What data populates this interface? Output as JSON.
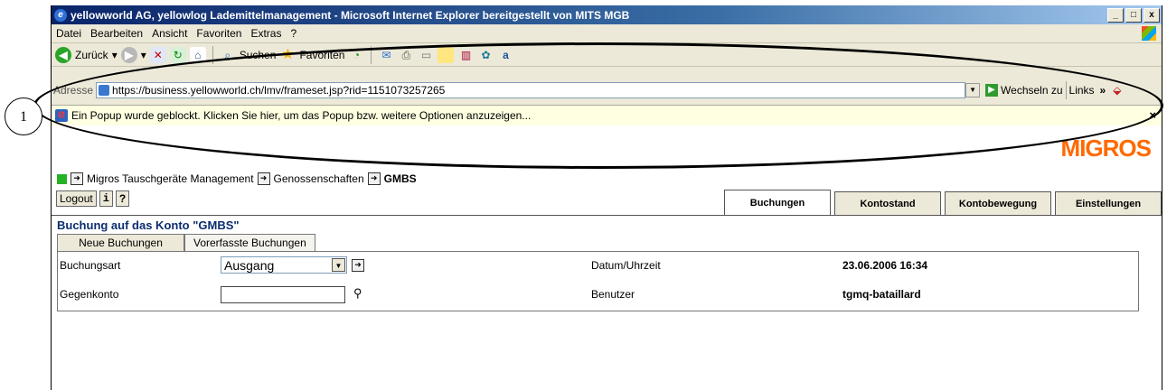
{
  "window": {
    "title": "yellowworld AG, yellowlog Lademittelmanagement - Microsoft Internet Explorer bereitgestellt von MITS MGB",
    "controls": [
      "_",
      "□",
      "x"
    ]
  },
  "menu": [
    "Datei",
    "Bearbeiten",
    "Ansicht",
    "Favoriten",
    "Extras",
    "?"
  ],
  "toolbar": {
    "back_label": "Zurück",
    "search_label": "Suchen",
    "favorites_label": "Favoriten"
  },
  "address": {
    "label": "Adresse",
    "url": "https://business.yellowworld.ch/lmv/frameset.jsp?rid=1151073257265",
    "go_label": "Wechseln zu",
    "links_label": "Links"
  },
  "popup": {
    "message": "Ein Popup wurde geblockt. Klicken Sie hier, um das Popup bzw. weitere Optionen anzuzeigen...",
    "close": "×"
  },
  "brand": "MIGROS",
  "breadcrumb": [
    "Migros Tauschgeräte Management",
    "Genossenschaften",
    "GMBS"
  ],
  "buttons": {
    "logout": "Logout",
    "info": "i",
    "help": "?"
  },
  "main_tabs": [
    "Buchungen",
    "Kontostand",
    "Kontobewegung",
    "Einstellungen"
  ],
  "heading": "Buchung auf das Konto \"GMBS\"",
  "sub_tabs": [
    "Neue Buchungen",
    "Vorerfasste Buchungen"
  ],
  "form": {
    "buchungsart_label": "Buchungsart",
    "buchungsart_value": "Ausgang",
    "gegenkonto_label": "Gegenkonto",
    "gegenkonto_value": "",
    "datum_label": "Datum/Uhrzeit",
    "datum_value": "23.06.2006 16:34",
    "benutzer_label": "Benutzer",
    "benutzer_value": "tgmq-bataillard"
  },
  "annotation": {
    "number": "1"
  }
}
